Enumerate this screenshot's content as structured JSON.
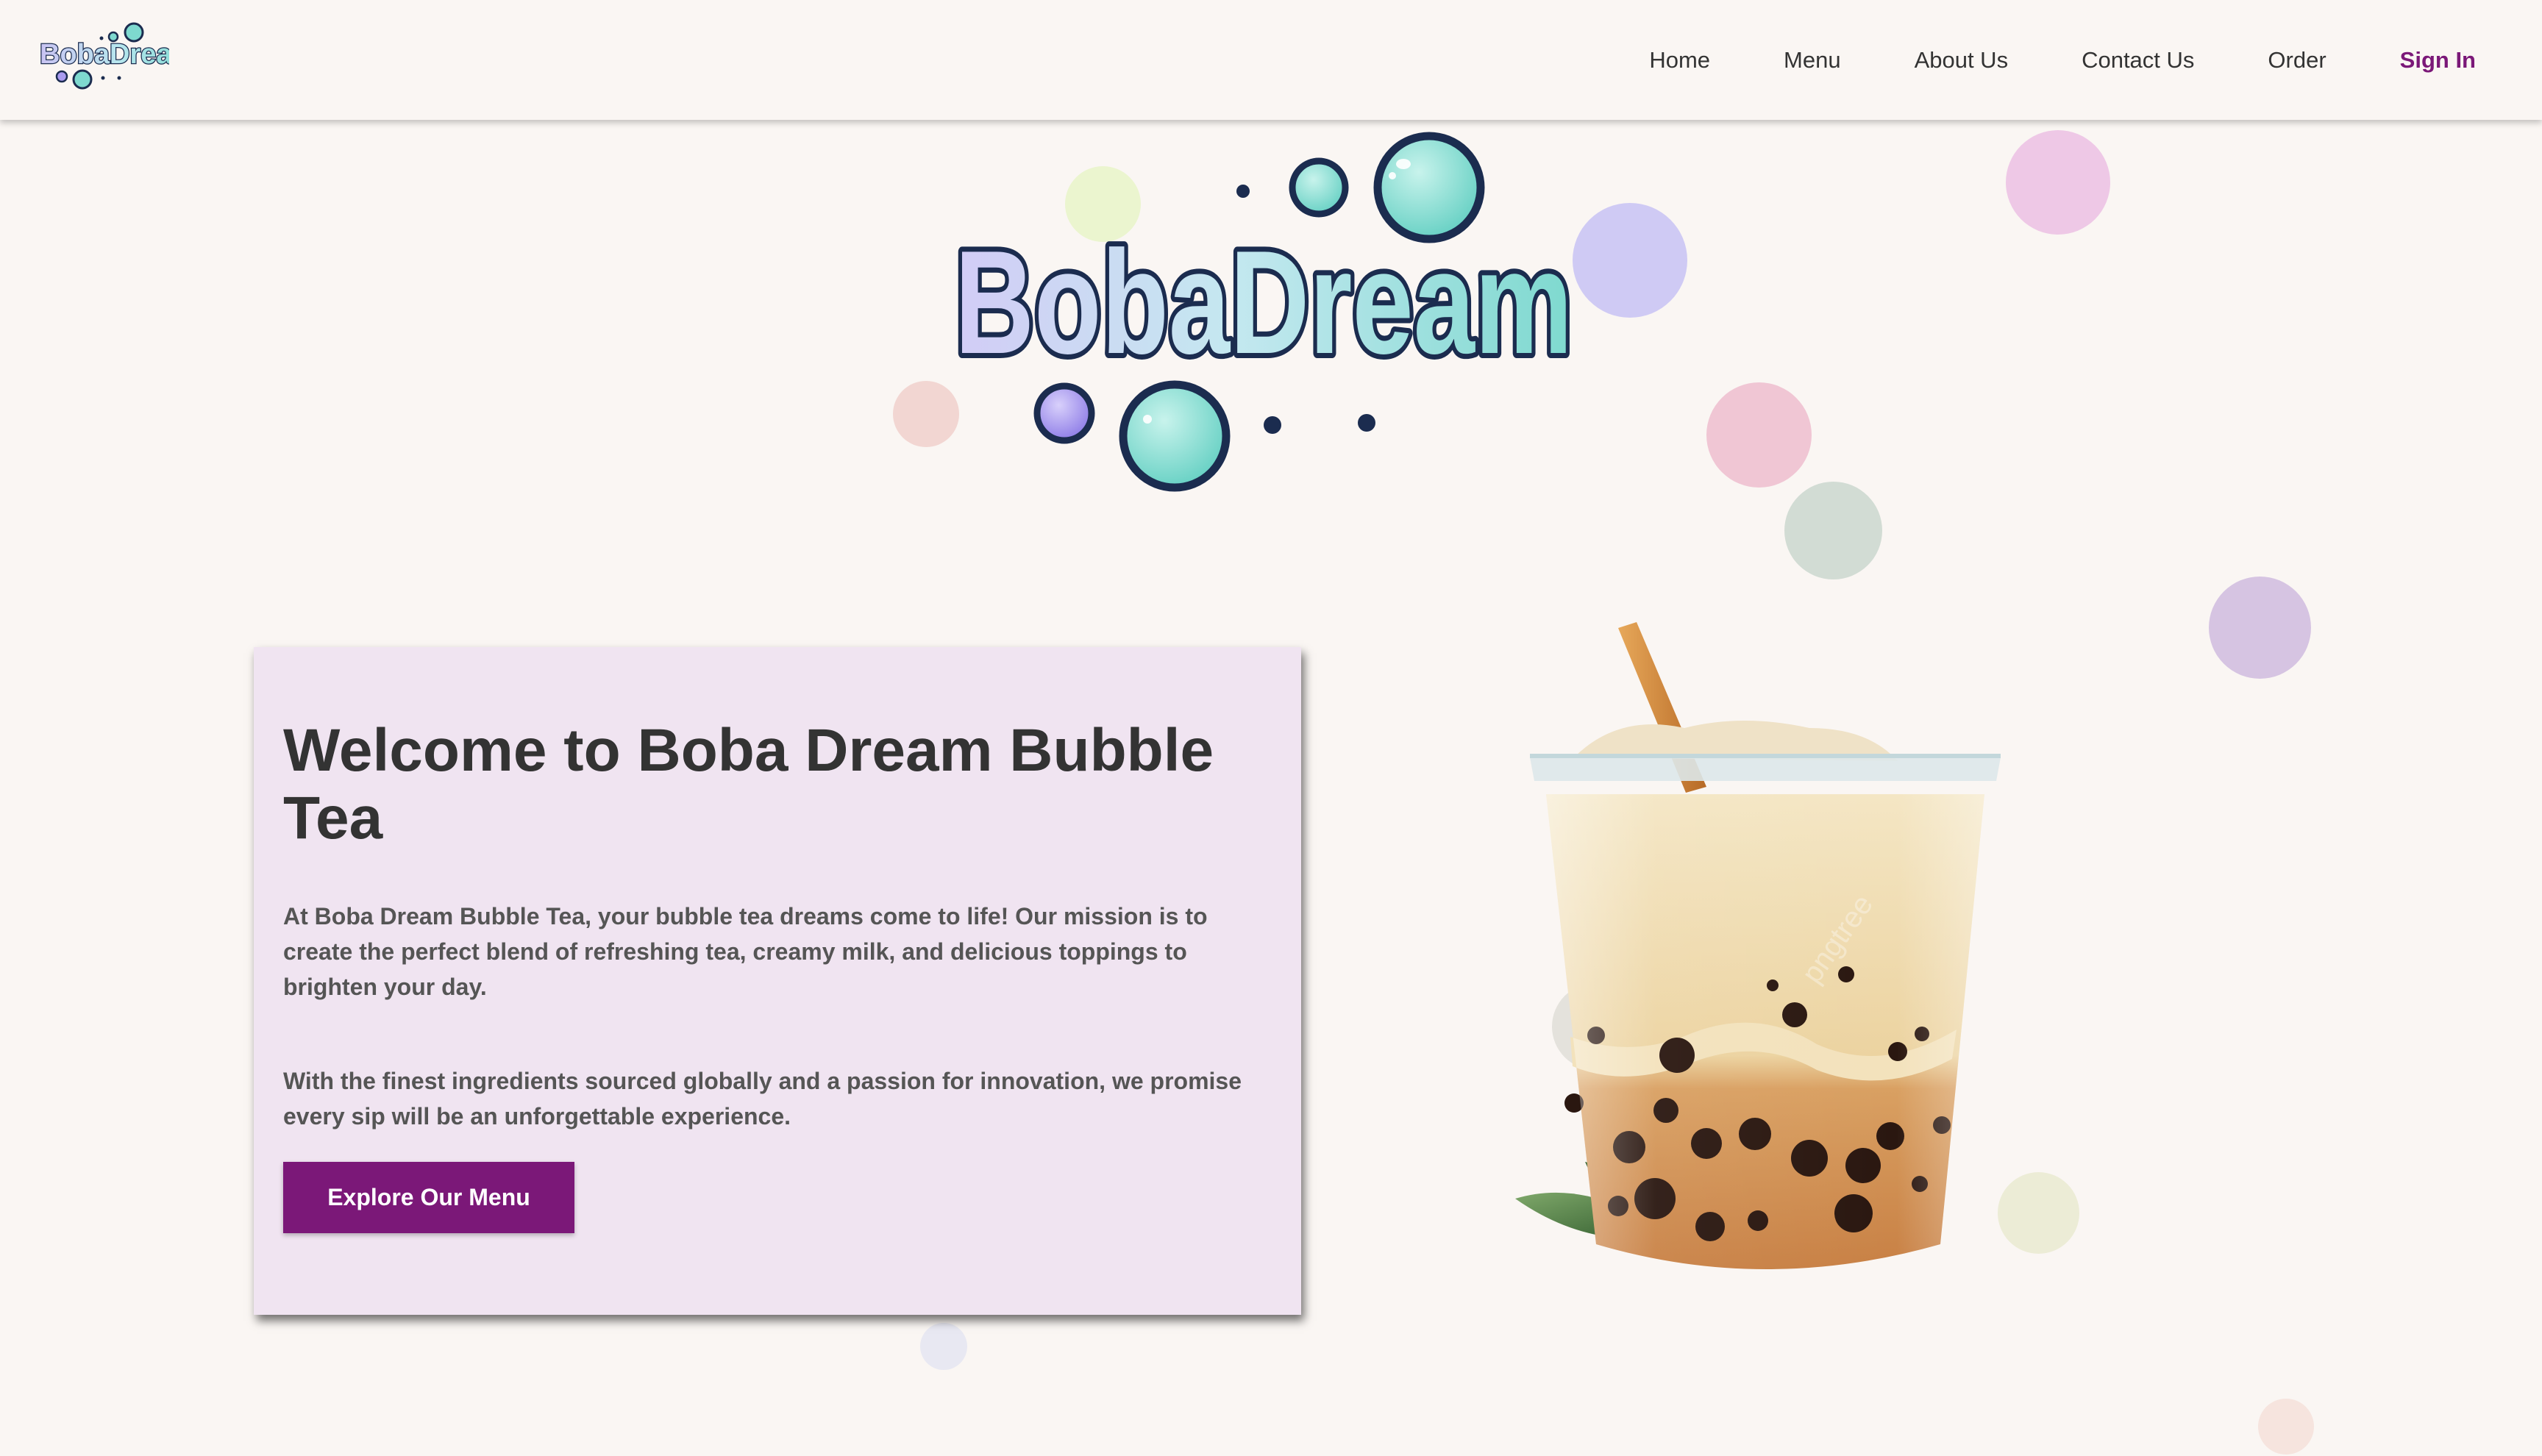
{
  "nav": {
    "logo_text": "BobaDream",
    "links": [
      "Home",
      "Menu",
      "About Us",
      "Contact Us",
      "Order"
    ],
    "sign_in": "Sign In"
  },
  "hero": {
    "logo_text": "BobaDream"
  },
  "card": {
    "title": "Welcome to Boba Dream Bubble Tea",
    "paragraph1": "At Boba Dream Bubble Tea, your bubble tea dreams come to life! Our mission is to create the perfect blend of refreshing tea, creamy milk, and delicious toppings to brighten your day.",
    "paragraph2": "With the finest ingredients sourced globally and a passion for innovation, we promise every sip will be an unforgettable experience.",
    "button": "Explore Our Menu"
  },
  "colors": {
    "accent": "#7b1878",
    "background": "#faf6f3",
    "card_background": "#f0e4f1",
    "logo_teal": "#7ed9cf",
    "logo_outline": "#1b2c4f"
  },
  "illustration": {
    "watermark": "pngtree"
  }
}
